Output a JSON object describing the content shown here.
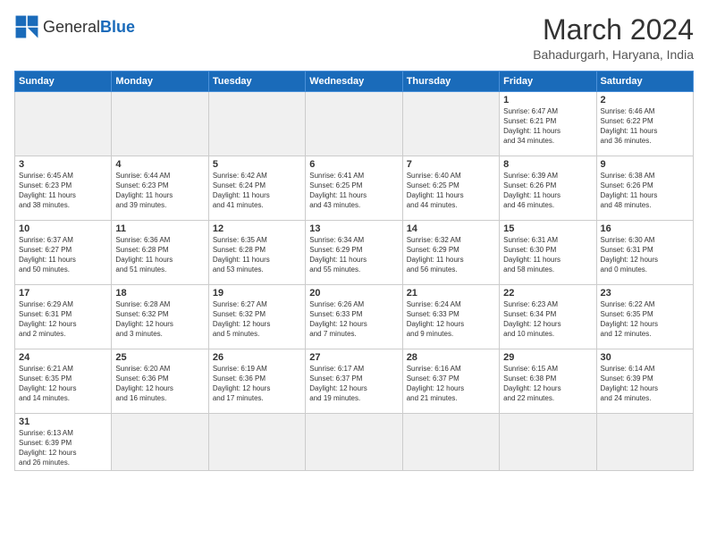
{
  "logo": {
    "general": "General",
    "blue": "Blue"
  },
  "header": {
    "month": "March 2024",
    "location": "Bahadurgarh, Haryana, India"
  },
  "weekdays": [
    "Sunday",
    "Monday",
    "Tuesday",
    "Wednesday",
    "Thursday",
    "Friday",
    "Saturday"
  ],
  "weeks": [
    [
      {
        "day": "",
        "info": ""
      },
      {
        "day": "",
        "info": ""
      },
      {
        "day": "",
        "info": ""
      },
      {
        "day": "",
        "info": ""
      },
      {
        "day": "",
        "info": ""
      },
      {
        "day": "1",
        "info": "Sunrise: 6:47 AM\nSunset: 6:21 PM\nDaylight: 11 hours\nand 34 minutes."
      },
      {
        "day": "2",
        "info": "Sunrise: 6:46 AM\nSunset: 6:22 PM\nDaylight: 11 hours\nand 36 minutes."
      }
    ],
    [
      {
        "day": "3",
        "info": "Sunrise: 6:45 AM\nSunset: 6:23 PM\nDaylight: 11 hours\nand 38 minutes."
      },
      {
        "day": "4",
        "info": "Sunrise: 6:44 AM\nSunset: 6:23 PM\nDaylight: 11 hours\nand 39 minutes."
      },
      {
        "day": "5",
        "info": "Sunrise: 6:42 AM\nSunset: 6:24 PM\nDaylight: 11 hours\nand 41 minutes."
      },
      {
        "day": "6",
        "info": "Sunrise: 6:41 AM\nSunset: 6:25 PM\nDaylight: 11 hours\nand 43 minutes."
      },
      {
        "day": "7",
        "info": "Sunrise: 6:40 AM\nSunset: 6:25 PM\nDaylight: 11 hours\nand 44 minutes."
      },
      {
        "day": "8",
        "info": "Sunrise: 6:39 AM\nSunset: 6:26 PM\nDaylight: 11 hours\nand 46 minutes."
      },
      {
        "day": "9",
        "info": "Sunrise: 6:38 AM\nSunset: 6:26 PM\nDaylight: 11 hours\nand 48 minutes."
      }
    ],
    [
      {
        "day": "10",
        "info": "Sunrise: 6:37 AM\nSunset: 6:27 PM\nDaylight: 11 hours\nand 50 minutes."
      },
      {
        "day": "11",
        "info": "Sunrise: 6:36 AM\nSunset: 6:28 PM\nDaylight: 11 hours\nand 51 minutes."
      },
      {
        "day": "12",
        "info": "Sunrise: 6:35 AM\nSunset: 6:28 PM\nDaylight: 11 hours\nand 53 minutes."
      },
      {
        "day": "13",
        "info": "Sunrise: 6:34 AM\nSunset: 6:29 PM\nDaylight: 11 hours\nand 55 minutes."
      },
      {
        "day": "14",
        "info": "Sunrise: 6:32 AM\nSunset: 6:29 PM\nDaylight: 11 hours\nand 56 minutes."
      },
      {
        "day": "15",
        "info": "Sunrise: 6:31 AM\nSunset: 6:30 PM\nDaylight: 11 hours\nand 58 minutes."
      },
      {
        "day": "16",
        "info": "Sunrise: 6:30 AM\nSunset: 6:31 PM\nDaylight: 12 hours\nand 0 minutes."
      }
    ],
    [
      {
        "day": "17",
        "info": "Sunrise: 6:29 AM\nSunset: 6:31 PM\nDaylight: 12 hours\nand 2 minutes."
      },
      {
        "day": "18",
        "info": "Sunrise: 6:28 AM\nSunset: 6:32 PM\nDaylight: 12 hours\nand 3 minutes."
      },
      {
        "day": "19",
        "info": "Sunrise: 6:27 AM\nSunset: 6:32 PM\nDaylight: 12 hours\nand 5 minutes."
      },
      {
        "day": "20",
        "info": "Sunrise: 6:26 AM\nSunset: 6:33 PM\nDaylight: 12 hours\nand 7 minutes."
      },
      {
        "day": "21",
        "info": "Sunrise: 6:24 AM\nSunset: 6:33 PM\nDaylight: 12 hours\nand 9 minutes."
      },
      {
        "day": "22",
        "info": "Sunrise: 6:23 AM\nSunset: 6:34 PM\nDaylight: 12 hours\nand 10 minutes."
      },
      {
        "day": "23",
        "info": "Sunrise: 6:22 AM\nSunset: 6:35 PM\nDaylight: 12 hours\nand 12 minutes."
      }
    ],
    [
      {
        "day": "24",
        "info": "Sunrise: 6:21 AM\nSunset: 6:35 PM\nDaylight: 12 hours\nand 14 minutes."
      },
      {
        "day": "25",
        "info": "Sunrise: 6:20 AM\nSunset: 6:36 PM\nDaylight: 12 hours\nand 16 minutes."
      },
      {
        "day": "26",
        "info": "Sunrise: 6:19 AM\nSunset: 6:36 PM\nDaylight: 12 hours\nand 17 minutes."
      },
      {
        "day": "27",
        "info": "Sunrise: 6:17 AM\nSunset: 6:37 PM\nDaylight: 12 hours\nand 19 minutes."
      },
      {
        "day": "28",
        "info": "Sunrise: 6:16 AM\nSunset: 6:37 PM\nDaylight: 12 hours\nand 21 minutes."
      },
      {
        "day": "29",
        "info": "Sunrise: 6:15 AM\nSunset: 6:38 PM\nDaylight: 12 hours\nand 22 minutes."
      },
      {
        "day": "30",
        "info": "Sunrise: 6:14 AM\nSunset: 6:39 PM\nDaylight: 12 hours\nand 24 minutes."
      }
    ],
    [
      {
        "day": "31",
        "info": "Sunrise: 6:13 AM\nSunset: 6:39 PM\nDaylight: 12 hours\nand 26 minutes."
      },
      {
        "day": "",
        "info": ""
      },
      {
        "day": "",
        "info": ""
      },
      {
        "day": "",
        "info": ""
      },
      {
        "day": "",
        "info": ""
      },
      {
        "day": "",
        "info": ""
      },
      {
        "day": "",
        "info": ""
      }
    ]
  ]
}
